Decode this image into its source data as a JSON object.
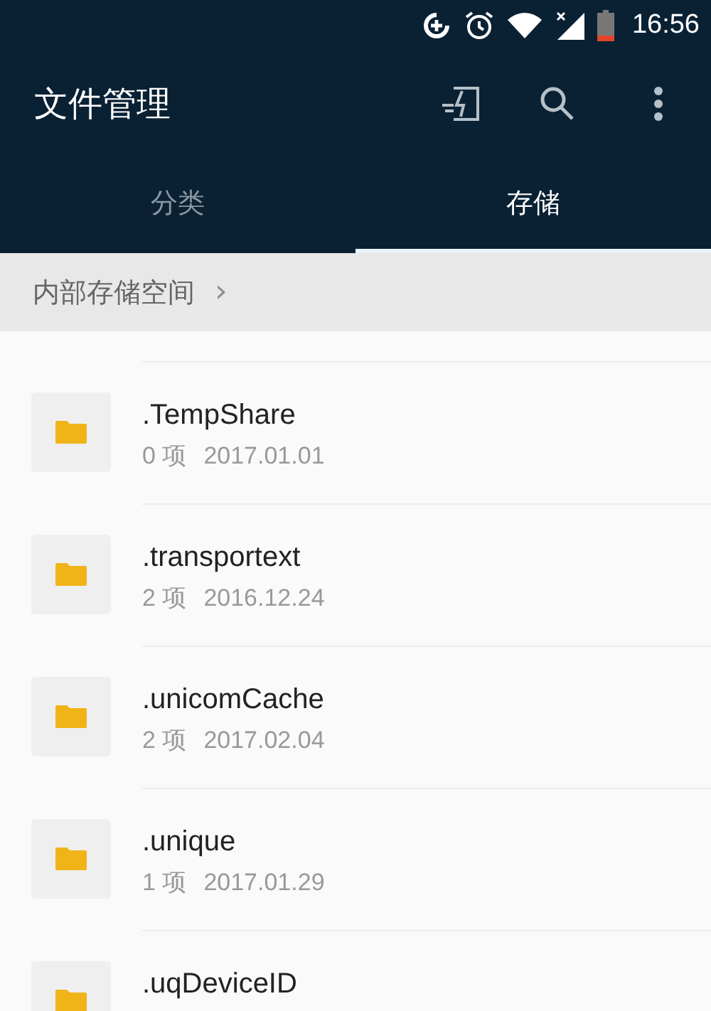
{
  "status_bar": {
    "time": "16:56"
  },
  "app_bar": {
    "title": "文件管理"
  },
  "tabs": [
    {
      "label": "分类",
      "selected": false
    },
    {
      "label": "存储",
      "selected": true
    }
  ],
  "breadcrumb": {
    "label": "内部存储空间",
    "separator": "›"
  },
  "files": [
    {
      "name": ".TempShare",
      "count": "0 项",
      "date": "2017.01.01"
    },
    {
      "name": ".transportext",
      "count": "2 项",
      "date": "2016.12.24"
    },
    {
      "name": ".unicomCache",
      "count": "2 项",
      "date": "2017.02.04"
    },
    {
      "name": ".unique",
      "count": "1 项",
      "date": "2017.01.29"
    },
    {
      "name": ".uqDeviceID"
    }
  ]
}
